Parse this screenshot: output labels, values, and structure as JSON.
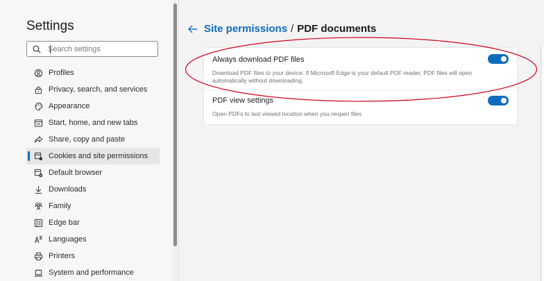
{
  "sidebar": {
    "title": "Settings",
    "search_placeholder": "Search settings",
    "items": [
      {
        "label": "Profiles",
        "icon": "profile-icon"
      },
      {
        "label": "Privacy, search, and services",
        "icon": "lock-icon"
      },
      {
        "label": "Appearance",
        "icon": "appearance-icon"
      },
      {
        "label": "Start, home, and new tabs",
        "icon": "home-tabs-icon"
      },
      {
        "label": "Share, copy and paste",
        "icon": "share-icon"
      },
      {
        "label": "Cookies and site permissions",
        "icon": "cookies-permissions-icon",
        "active": true
      },
      {
        "label": "Default browser",
        "icon": "default-browser-icon"
      },
      {
        "label": "Downloads",
        "icon": "download-icon"
      },
      {
        "label": "Family",
        "icon": "family-icon"
      },
      {
        "label": "Edge bar",
        "icon": "edge-bar-icon"
      },
      {
        "label": "Languages",
        "icon": "languages-icon"
      },
      {
        "label": "Printers",
        "icon": "printer-icon"
      },
      {
        "label": "System and performance",
        "icon": "laptop-icon"
      }
    ]
  },
  "header": {
    "breadcrumb_link": "Site permissions",
    "separator": "/",
    "current": "PDF documents"
  },
  "settings": [
    {
      "title": "Always download PDF files",
      "description": "Download PDF files to your device. If Microsoft Edge is your default PDF reader, PDF files will open automatically without downloading.",
      "enabled": true
    },
    {
      "title": "PDF view settings",
      "description": "Open PDFs to last viewed location when you reopen files",
      "enabled": true
    }
  ],
  "colors": {
    "accent": "#0f6cbd",
    "annotation": "#d0021b"
  }
}
